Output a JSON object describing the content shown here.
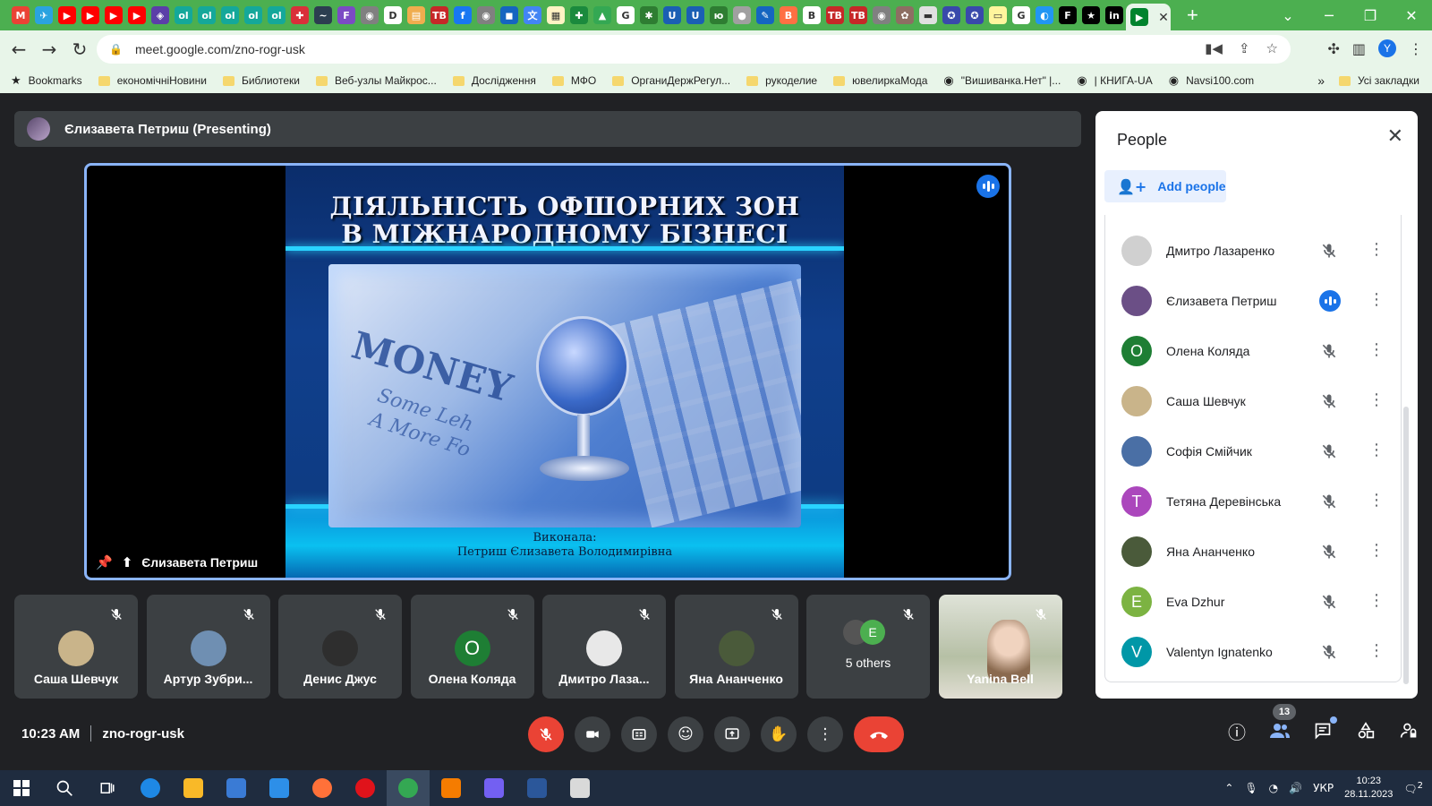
{
  "browser": {
    "url": "meet.google.com/zno-rogr-usk",
    "profile_initial": "Y",
    "tab_favicons": [
      {
        "color": "#ea4335",
        "glyph": "M"
      },
      {
        "color": "#2aa3e0",
        "glyph": "✈"
      },
      {
        "color": "#ff0000",
        "glyph": "▶"
      },
      {
        "color": "#ff0000",
        "glyph": "▶"
      },
      {
        "color": "#ff0000",
        "glyph": "▶"
      },
      {
        "color": "#ff0000",
        "glyph": "▶"
      },
      {
        "color": "#5b3fa8",
        "glyph": "◈"
      },
      {
        "color": "#14a89a",
        "glyph": "ol"
      },
      {
        "color": "#14a89a",
        "glyph": "ol"
      },
      {
        "color": "#14a89a",
        "glyph": "ol"
      },
      {
        "color": "#14a89a",
        "glyph": "ol"
      },
      {
        "color": "#14a89a",
        "glyph": "ol"
      },
      {
        "color": "#d9303a",
        "glyph": "✚"
      },
      {
        "color": "#2c3e50",
        "glyph": "~"
      },
      {
        "color": "#7b4bc4",
        "glyph": "F"
      },
      {
        "color": "#808080",
        "glyph": "◉"
      },
      {
        "color": "#ffffff",
        "glyph": "D"
      },
      {
        "color": "#f0ad4e",
        "glyph": "▤"
      },
      {
        "color": "#c62828",
        "glyph": "TB"
      },
      {
        "color": "#1877f2",
        "glyph": "f"
      },
      {
        "color": "#808080",
        "glyph": "◉"
      },
      {
        "color": "#1565c0",
        "glyph": "◼"
      },
      {
        "color": "#4285f4",
        "glyph": "文"
      },
      {
        "color": "#fff3c4",
        "glyph": "▦"
      },
      {
        "color": "#1b8a3d",
        "glyph": "✚"
      },
      {
        "color": "#34a853",
        "glyph": "▲"
      },
      {
        "color": "#ffffff",
        "glyph": "G"
      },
      {
        "color": "#2e7d32",
        "glyph": "✱"
      },
      {
        "color": "#1a5fb4",
        "glyph": "U"
      },
      {
        "color": "#1a5fb4",
        "glyph": "U"
      },
      {
        "color": "#2e7d32",
        "glyph": "ю"
      },
      {
        "color": "#a0a0a0",
        "glyph": "●"
      },
      {
        "color": "#1565c0",
        "glyph": "✎"
      },
      {
        "color": "#ff7043",
        "glyph": "B"
      },
      {
        "color": "#ffffff",
        "glyph": "B"
      },
      {
        "color": "#c62828",
        "glyph": "TB"
      },
      {
        "color": "#c62828",
        "glyph": "TB"
      },
      {
        "color": "#808080",
        "glyph": "◉"
      },
      {
        "color": "#8d6e63",
        "glyph": "✿"
      },
      {
        "color": "#e0e0e0",
        "glyph": "▬"
      },
      {
        "color": "#3949ab",
        "glyph": "✪"
      },
      {
        "color": "#3949ab",
        "glyph": "✪"
      },
      {
        "color": "#fff59d",
        "glyph": "▭"
      },
      {
        "color": "#ffffff",
        "glyph": "G"
      },
      {
        "color": "#2196f3",
        "glyph": "◐"
      },
      {
        "color": "#000000",
        "glyph": "F"
      },
      {
        "color": "#000000",
        "glyph": "★"
      },
      {
        "color": "#000000",
        "glyph": "in"
      }
    ],
    "bookmarks": [
      {
        "label": "Bookmarks",
        "type": "star"
      },
      {
        "label": "економічніНовини",
        "type": "folder"
      },
      {
        "label": "Библиотеки",
        "type": "folder"
      },
      {
        "label": "Веб-узлы Майкрос...",
        "type": "folder"
      },
      {
        "label": "Дослідження",
        "type": "folder"
      },
      {
        "label": "МФО",
        "type": "folder"
      },
      {
        "label": "ОрганиДержРегул...",
        "type": "folder"
      },
      {
        "label": "рукоделие",
        "type": "folder"
      },
      {
        "label": "ювелиркаМода",
        "type": "folder"
      },
      {
        "label": "\"Вишиванка.Нет\" |...",
        "type": "site"
      },
      {
        "label": "| КНИГА-UA",
        "type": "site"
      },
      {
        "label": "Navsi100.com",
        "type": "site"
      }
    ],
    "bookmarks_more": "»",
    "all_bookmarks": "Усі закладки"
  },
  "meet": {
    "presenter_title": "Єлизавета Петриш (Presenting)",
    "stage_name": "Єлизавета Петриш",
    "slide": {
      "title_line1": "ДІЯЛЬНІСТЬ ОФШОРНИХ ЗОН",
      "title_line2": "В МІЖНАРОДНОМУ БІЗНЕСІ",
      "photo_word": "MONEY",
      "photo_text_line1": "Some Leh",
      "photo_text_line2": "A More Fo",
      "credits_line1": "Виконала:",
      "credits_line2": "Петриш Єлизавета Володимирівна"
    },
    "tiles": [
      {
        "name": "Саша Шевчук",
        "avatar_color": "#c9b48a",
        "initial": ""
      },
      {
        "name": "Артур Зубри...",
        "avatar_color": "#6f8fb2",
        "initial": ""
      },
      {
        "name": "Денис Джус",
        "avatar_color": "#2e2e2e",
        "initial": ""
      },
      {
        "name": "Олена Коляда",
        "avatar_color": "#1e7e34",
        "initial": "О"
      },
      {
        "name": "Дмитро Лаза...",
        "avatar_color": "#e8e8e8",
        "initial": ""
      },
      {
        "name": "Яна Ананченко",
        "avatar_color": "#4a5a3a",
        "initial": ""
      },
      {
        "name": "5 others",
        "avatar_color": "#4caf50",
        "initial": "E"
      },
      {
        "name": "Yanina Bell",
        "avatar_color": "",
        "initial": ""
      }
    ],
    "time": "10:23 AM",
    "meeting_code": "zno-rogr-usk",
    "participant_count": "13"
  },
  "people_panel": {
    "title": "People",
    "add_label": "Add people",
    "participants": [
      {
        "name": "Дмитро Лазаренко",
        "color": "#d0d0d0",
        "initial": "",
        "speaking": false
      },
      {
        "name": "Єлизавета Петриш",
        "color": "#6b4f86",
        "initial": "",
        "speaking": true
      },
      {
        "name": "Олена Коляда",
        "color": "#1e7e34",
        "initial": "О",
        "speaking": false
      },
      {
        "name": "Саша Шевчук",
        "color": "#c9b48a",
        "initial": "",
        "speaking": false
      },
      {
        "name": "Софія Смійчик",
        "color": "#4a6fa5",
        "initial": "",
        "speaking": false
      },
      {
        "name": "Тетяна Деревінська",
        "color": "#ab47bc",
        "initial": "Т",
        "speaking": false
      },
      {
        "name": "Яна Ананченко",
        "color": "#4a5a3a",
        "initial": "",
        "speaking": false
      },
      {
        "name": "Eva Dzhur",
        "color": "#7cb342",
        "initial": "E",
        "speaking": false
      },
      {
        "name": "Valentyn Ignatenko",
        "color": "#0097a7",
        "initial": "V",
        "speaking": false
      }
    ]
  },
  "taskbar": {
    "apps": [
      {
        "name": "edge",
        "color": "#1e88e5"
      },
      {
        "name": "explorer",
        "color": "#f9b928"
      },
      {
        "name": "store",
        "color": "#3a7bd5"
      },
      {
        "name": "mail",
        "color": "#2d8fe8"
      },
      {
        "name": "firefox",
        "color": "#ff7139"
      },
      {
        "name": "opera",
        "color": "#e0131b"
      },
      {
        "name": "chrome",
        "color": "#34a853"
      },
      {
        "name": "notes",
        "color": "#f57c00"
      },
      {
        "name": "viber",
        "color": "#7360f2"
      },
      {
        "name": "word",
        "color": "#2b579a"
      },
      {
        "name": "media",
        "color": "#d9d9d9"
      }
    ],
    "language": "УКР",
    "clock_time": "10:23",
    "clock_date": "28.11.2023",
    "notifications": "2"
  }
}
